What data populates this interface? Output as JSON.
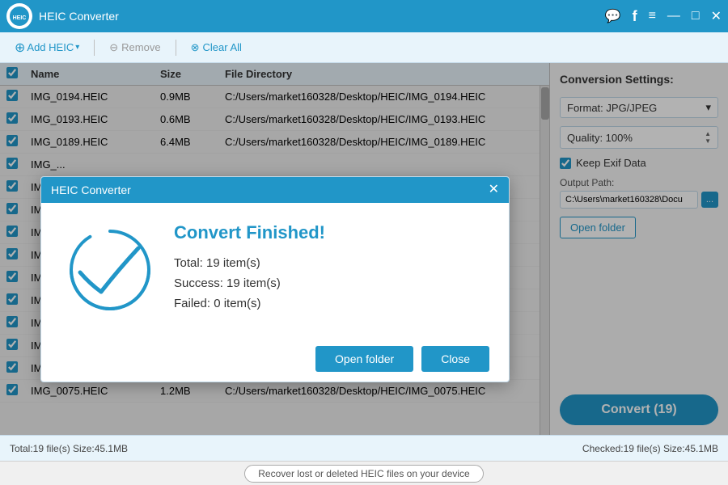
{
  "titleBar": {
    "appName": "HEIC Converter",
    "logoText": "HEIC",
    "icons": {
      "chat": "💬",
      "facebook": "f",
      "menu": "≡",
      "minimize": "—",
      "maximize": "□",
      "close": "✕"
    }
  },
  "toolbar": {
    "addHeic": "Add HEIC",
    "remove": "Remove",
    "clearAll": "Clear All"
  },
  "fileList": {
    "columns": [
      "",
      "Name",
      "Size",
      "File Directory"
    ],
    "rows": [
      {
        "name": "IMG_0194.HEIC",
        "size": "0.9MB",
        "path": "C:/Users/market160328/Desktop/HEIC/IMG_0194.HEIC",
        "checked": true
      },
      {
        "name": "IMG_0193.HEIC",
        "size": "0.6MB",
        "path": "C:/Users/market160328/Desktop/HEIC/IMG_0193.HEIC",
        "checked": true
      },
      {
        "name": "IMG_0189.HEIC",
        "size": "6.4MB",
        "path": "C:/Users/market160328/Desktop/HEIC/IMG_0189.HEIC",
        "checked": true
      },
      {
        "name": "IMG_...",
        "size": "",
        "path": "",
        "checked": true
      },
      {
        "name": "IMG_...",
        "size": "",
        "path": "",
        "checked": true
      },
      {
        "name": "IMG_...",
        "size": "",
        "path": "",
        "checked": true
      },
      {
        "name": "IMG_...",
        "size": "",
        "path": "",
        "checked": true
      },
      {
        "name": "IMG_...",
        "size": "",
        "path": "",
        "checked": true
      },
      {
        "name": "IMG_...",
        "size": "",
        "path": "",
        "checked": true
      },
      {
        "name": "IMG_...",
        "size": "",
        "path": "",
        "checked": true
      },
      {
        "name": "IMG_...",
        "size": "",
        "path": "",
        "checked": true
      },
      {
        "name": "IMG_...",
        "size": "",
        "path": "",
        "checked": true
      },
      {
        "name": "IMG_...",
        "size": "",
        "path": "",
        "checked": true
      },
      {
        "name": "IMG_0075.HEIC",
        "size": "1.2MB",
        "path": "C:/Users/market160328/Desktop/HEIC/IMG_0075.HEIC",
        "checked": true
      }
    ]
  },
  "settings": {
    "title": "Conversion Settings:",
    "formatLabel": "Format: JPG/JPEG",
    "qualityLabel": "Quality: 100%",
    "keepExif": "Keep Exif Data",
    "outputPathLabel": "Output Path:",
    "outputPath": "C:\\Users\\market160328\\Docu",
    "browseLabel": "...",
    "openFolderLabel": "Open folder",
    "convertLabel": "Convert (19)"
  },
  "statusBar": {
    "leftText": "Total:19 file(s)  Size:45.1MB",
    "rightText": "Checked:19 file(s)  Size:45.1MB"
  },
  "bottomBar": {
    "recoverLink": "Recover lost or deleted HEIC files on your device"
  },
  "modal": {
    "title": "HEIC Converter",
    "closeBtn": "✕",
    "heading": "Convert Finished!",
    "stats": {
      "total": "Total: 19 item(s)",
      "success": "Success: 19 item(s)",
      "failed": "Failed: 0 item(s)"
    },
    "openFolderLabel": "Open folder",
    "closeLabel": "Close"
  }
}
